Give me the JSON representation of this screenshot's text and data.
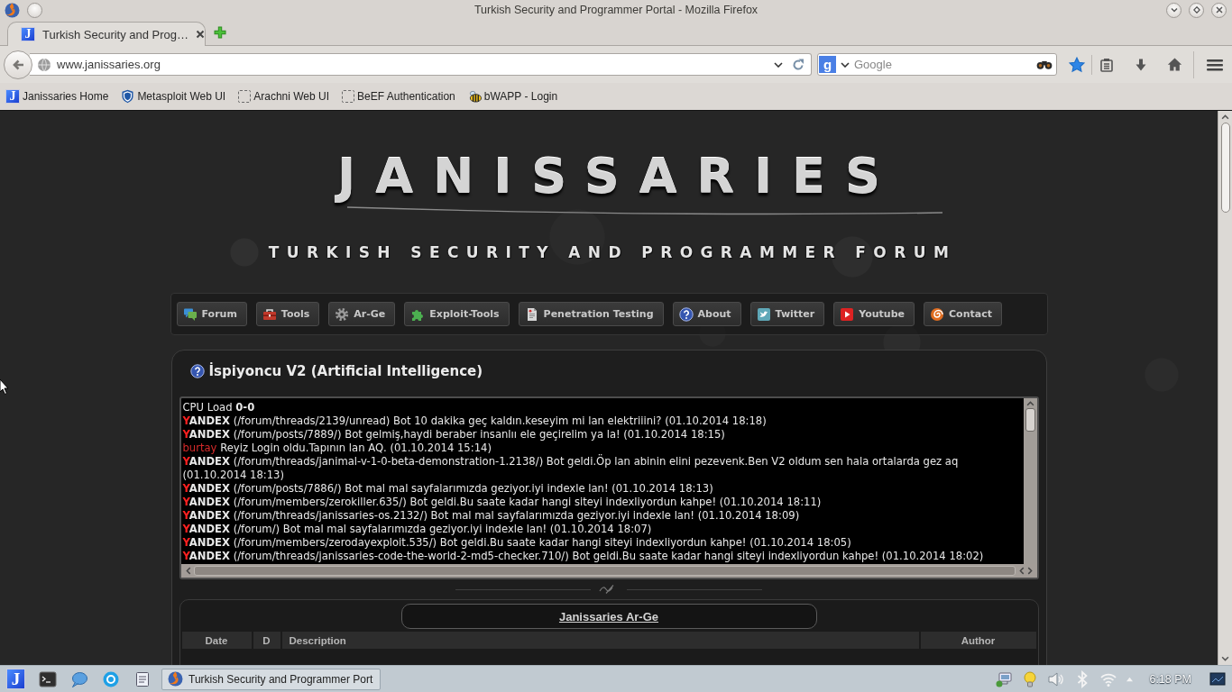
{
  "window": {
    "title": "Turkish Security and Programmer Portal - Mozilla Firefox"
  },
  "tabs": [
    {
      "label": "Turkish Security and Prog…",
      "icon_text": "J",
      "selected": true
    }
  ],
  "address_bar": {
    "url": "www.janissaries.org"
  },
  "search": {
    "engine_icon_text": "g",
    "placeholder": "Google"
  },
  "toolbar": {
    "page_bookmarked": true
  },
  "bookmarks": [
    {
      "label": "Janissaries Home",
      "kind": "logo",
      "icon_text": "J"
    },
    {
      "label": "Metasploit Web UI",
      "kind": "shield"
    },
    {
      "label": "Arachni Web UI",
      "kind": "blank"
    },
    {
      "label": "BeEF Authentication",
      "kind": "blank"
    },
    {
      "label": "bWAPP - Login",
      "kind": "bee"
    }
  ],
  "site": {
    "logo": "JANISSARIES",
    "tagline": "TURKISH SECURITY AND PROGRAMMER FORUM"
  },
  "nav": [
    {
      "label": "Forum",
      "kind": "chat"
    },
    {
      "label": "Tools",
      "kind": "toolbox"
    },
    {
      "label": "Ar-Ge",
      "kind": "gear"
    },
    {
      "label": "Exploit-Tools",
      "kind": "puzzle"
    },
    {
      "label": "Penetration Testing",
      "kind": "document"
    },
    {
      "label": "About",
      "kind": "help"
    },
    {
      "label": "Twitter",
      "kind": "bird"
    },
    {
      "label": "Youtube",
      "kind": "play"
    },
    {
      "label": "Contact",
      "kind": "swirl"
    }
  ],
  "panel": {
    "title": "İspiyoncu V2 (Artificial Intelligence)",
    "cpu": {
      "label": "CPU Load",
      "value": "0-0"
    },
    "log": [
      {
        "kind": "bot",
        "name_initial": "Y",
        "name_rest": "ANDEX",
        "text": "(/forum/threads/2139/unread) Bot 10 dakika geç kaldın.keseyim mi lan elektriiini? (01.10.2014 18:18)"
      },
      {
        "kind": "bot",
        "name_initial": "Y",
        "name_rest": "ANDEX",
        "text": "(/forum/posts/7889/) Bot gelmiş,haydi beraber insanlıı ele geçirelim ya la! (01.10.2014 18:15)"
      },
      {
        "kind": "user",
        "name": "burtay",
        "text": "Reyiz Login oldu.Tapının lan AQ. (01.10.2014 15:14)"
      },
      {
        "kind": "bot",
        "name_initial": "Y",
        "name_rest": "ANDEX",
        "text": "(/forum/threads/janimal-v-1-0-beta-demonstration-1.2138/) Bot geldi.Öp lan abinin elini pezevenk.Ben V2 oldum sen hala ortalarda gez aq (01.10.2014 18:13)"
      },
      {
        "kind": "bot",
        "name_initial": "Y",
        "name_rest": "ANDEX",
        "text": "(/forum/posts/7886/) Bot mal mal sayfalarımızda geziyor.iyi indexle lan! (01.10.2014 18:13)"
      },
      {
        "kind": "bot",
        "name_initial": "Y",
        "name_rest": "ANDEX",
        "text": "(/forum/members/zerokiller.635/) Bot geldi.Bu saate kadar hangi siteyi indexliyordun kahpe! (01.10.2014 18:11)"
      },
      {
        "kind": "bot",
        "name_initial": "Y",
        "name_rest": "ANDEX",
        "text": "(/forum/threads/janissaries-os.2132/) Bot mal mal sayfalarımızda geziyor.iyi indexle lan! (01.10.2014 18:09)"
      },
      {
        "kind": "bot",
        "name_initial": "Y",
        "name_rest": "ANDEX",
        "text": "(/forum/) Bot mal mal sayfalarımızda geziyor.iyi indexle lan! (01.10.2014 18:07)"
      },
      {
        "kind": "bot",
        "name_initial": "Y",
        "name_rest": "ANDEX",
        "text": "(/forum/members/zerodayexploit.535/) Bot geldi.Bu saate kadar hangi siteyi indexliyordun kahpe! (01.10.2014 18:05)"
      },
      {
        "kind": "bot",
        "name_initial": "Y",
        "name_rest": "ANDEX",
        "text": "(/forum/threads/janissaries-code-the-world-2-md5-checker.710/) Bot geldi.Bu saate kadar hangi siteyi indexliyordun kahpe! (01.10.2014 18:02)"
      }
    ]
  },
  "ar_ge": {
    "title": "Janissaries Ar-Ge",
    "columns": [
      "Date",
      "D",
      "Description",
      "Author"
    ]
  },
  "taskbar": {
    "launcher_text": "J",
    "launchers": [
      {
        "kind": "terminal"
      },
      {
        "kind": "chat"
      },
      {
        "kind": "app"
      },
      {
        "kind": "notes"
      }
    ],
    "tasks": [
      {
        "label": "Turkish Security and Programmer Port",
        "selected": true
      }
    ],
    "clock": "6:18 PM"
  }
}
